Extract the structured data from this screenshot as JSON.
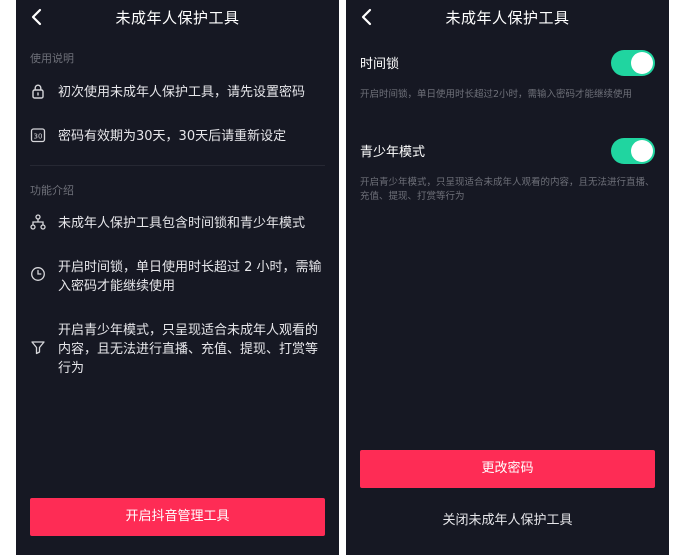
{
  "left": {
    "title": "未成年人保护工具",
    "usage_section": "使用说明",
    "usage_items": [
      {
        "icon": "lock-icon",
        "text": "初次使用未成年人保护工具，请先设置密码"
      },
      {
        "icon": "calendar-30-icon",
        "icon_text": "30",
        "text": "密码有效期为30天，30天后请重新设定"
      }
    ],
    "feature_section": "功能介绍",
    "feature_items": [
      {
        "icon": "branch-icon",
        "text": "未成年人保护工具包含时间锁和青少年模式"
      },
      {
        "icon": "clock-icon",
        "text": "开启时间锁，单日使用时长超过 2 小时，需输入密码才能继续使用"
      },
      {
        "icon": "filter-icon",
        "text": "开启青少年模式，只呈现适合未成年人观看的内容，且无法进行直播、充值、提现、打赏等行为"
      }
    ],
    "button_label": "开启抖音管理工具"
  },
  "right": {
    "title": "未成年人保护工具",
    "settings": [
      {
        "name": "时间锁",
        "desc": "开启时间锁，单日使用时长超过2小时，需输入密码才能继续使用",
        "enabled": true
      },
      {
        "name": "青少年模式",
        "desc": "开启青少年模式，只呈现适合未成年人观看的内容，且无法进行直播、充值、提现、打赏等行为",
        "enabled": true
      }
    ],
    "primary_button": "更改密码",
    "close_link": "关闭未成年人保护工具"
  },
  "colors": {
    "background": "#161823",
    "accent": "#fe2c55",
    "toggle_on": "#20d5a0",
    "muted_text": "#6e7079"
  }
}
